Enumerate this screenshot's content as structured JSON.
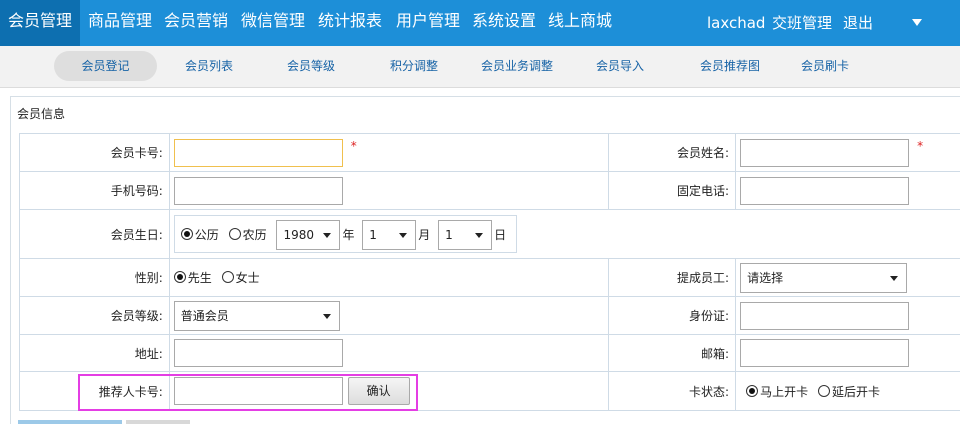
{
  "topnav": {
    "items": [
      {
        "label": "会员管理",
        "active": true
      },
      {
        "label": "商品管理"
      },
      {
        "label": "会员营销"
      },
      {
        "label": "微信管理"
      },
      {
        "label": "统计报表"
      },
      {
        "label": "用户管理"
      },
      {
        "label": "系统设置"
      },
      {
        "label": "线上商城"
      }
    ],
    "username": "laxchad",
    "shift": "交班管理",
    "logout": "退出"
  },
  "subnav": {
    "items": [
      {
        "label": "会员登记",
        "active": true
      },
      {
        "label": "会员列表"
      },
      {
        "label": "会员等级"
      },
      {
        "label": "积分调整"
      },
      {
        "label": "会员业务调整"
      },
      {
        "label": "会员导入"
      },
      {
        "label": "会员推荐图"
      },
      {
        "label": "会员刷卡"
      }
    ]
  },
  "panel": {
    "title": "会员信息"
  },
  "form": {
    "card_no_label": "会员卡号:",
    "card_no_value": "",
    "name_label": "会员姓名:",
    "name_value": "",
    "required_mark": "*",
    "mobile_label": "手机号码:",
    "mobile_value": "",
    "phone_label": "固定电话:",
    "phone_value": "",
    "birthday_label": "会员生日:",
    "calendar_solar": "公历",
    "calendar_lunar": "农历",
    "year_value": "1980",
    "year_unit": "年",
    "month_value": "1",
    "month_unit": "月",
    "day_value": "1",
    "day_unit": "日",
    "gender_label": "性别:",
    "gender_male": "先生",
    "gender_female": "女士",
    "staff_label": "提成员工:",
    "staff_value": "请选择",
    "level_label": "会员等级:",
    "level_value": "普通会员",
    "id_label": "身份证:",
    "id_value": "",
    "address_label": "地址:",
    "address_value": "",
    "email_label": "邮箱:",
    "email_value": "",
    "referrer_label": "推荐人卡号:",
    "referrer_value": "",
    "confirm_button": "确认",
    "card_status_label": "卡状态:",
    "card_status_now": "马上开卡",
    "card_status_later": "延后开卡"
  },
  "colors": {
    "topbar": "#1d8fd8",
    "topbar_active": "#0d6fb0",
    "subnav_text": "#1763a6",
    "required": "#d22222",
    "highlight": "#e43ee4"
  }
}
